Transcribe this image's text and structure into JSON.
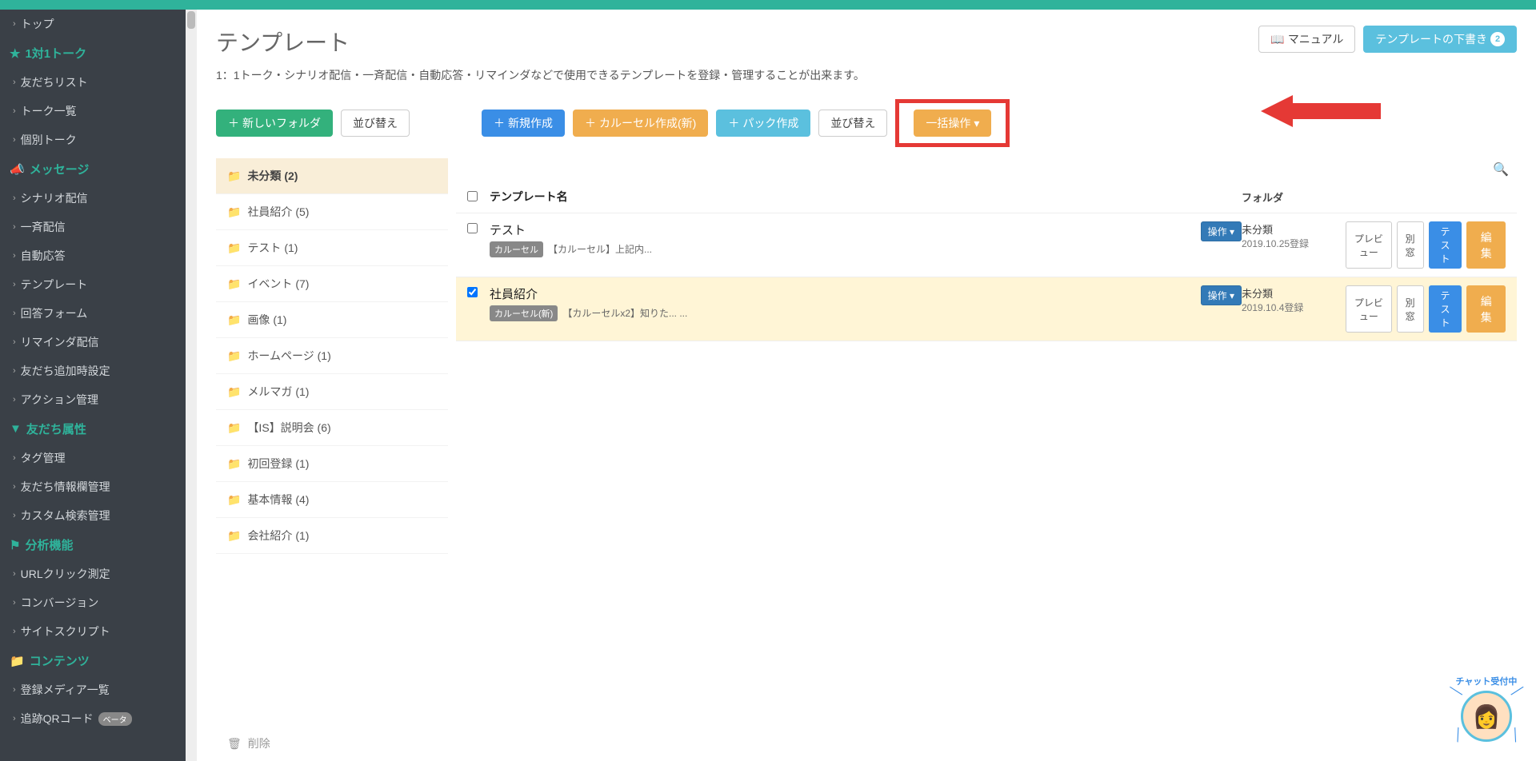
{
  "sidebar": {
    "top": "トップ",
    "sec1": {
      "header": "1対1トーク",
      "items": [
        "友だちリスト",
        "トーク一覧",
        "個別トーク"
      ]
    },
    "sec2": {
      "header": "メッセージ",
      "items": [
        "シナリオ配信",
        "一斉配信",
        "自動応答",
        "テンプレート",
        "回答フォーム",
        "リマインダ配信",
        "友だち追加時設定",
        "アクション管理"
      ]
    },
    "sec3": {
      "header": "友だち属性",
      "items": [
        "タグ管理",
        "友だち情報欄管理",
        "カスタム検索管理"
      ]
    },
    "sec4": {
      "header": "分析機能",
      "items": [
        "URLクリック測定",
        "コンバージョン",
        "サイトスクリプト"
      ]
    },
    "sec5": {
      "header": "コンテンツ",
      "items": [
        "登録メディア一覧",
        "追跡QRコード"
      ],
      "beta": "ベータ"
    }
  },
  "page": {
    "title": "テンプレート",
    "manual_btn": "マニュアル",
    "draft_btn": "テンプレートの下書き",
    "draft_count": "2",
    "desc": "1：1トーク・シナリオ配信・一斉配信・自動応答・リマインダなどで使用できるテンプレートを登録・管理することが出来ます。"
  },
  "toolbar": {
    "new_folder": "新しいフォルダ",
    "sort_folder": "並び替え",
    "new_create": "新規作成",
    "carousel_new": "カルーセル作成(新)",
    "pack_create": "パック作成",
    "sort_tpl": "並び替え",
    "bulk": "一括操作"
  },
  "folders": [
    {
      "label": "未分類 (2)",
      "selected": true
    },
    {
      "label": "社員紹介 (5)"
    },
    {
      "label": "テスト (1)"
    },
    {
      "label": "イベント (7)"
    },
    {
      "label": "画像 (1)"
    },
    {
      "label": "ホームページ (1)"
    },
    {
      "label": "メルマガ (1)"
    },
    {
      "label": "【IS】説明会 (6)"
    },
    {
      "label": "初回登録 (1)"
    },
    {
      "label": "基本情報 (4)"
    },
    {
      "label": "会社紹介 (1)"
    }
  ],
  "folder_delete": "削除",
  "tpl_header": {
    "name": "テンプレート名",
    "folder": "フォルダ"
  },
  "rows": [
    {
      "checked": false,
      "title": "テスト",
      "tag": "カルーセル",
      "sub": "【カルーセル】上記内...",
      "op": "操作 ▾",
      "folder": "未分類",
      "date": "2019.10.25登録",
      "preview": "プレビュー",
      "window": "別窓",
      "test": "テスト",
      "edit": "編集",
      "selected": false
    },
    {
      "checked": true,
      "title": "社員紹介",
      "tag": "カルーセル(新)",
      "sub": "【カルーセルx2】知りた... ...",
      "op": "操作 ▾",
      "folder": "未分類",
      "date": "2019.10.4登録",
      "preview": "プレビュー",
      "window": "別窓",
      "test": "テスト",
      "edit": "編集",
      "selected": true
    }
  ],
  "chat": {
    "label": "チャット受付中"
  }
}
